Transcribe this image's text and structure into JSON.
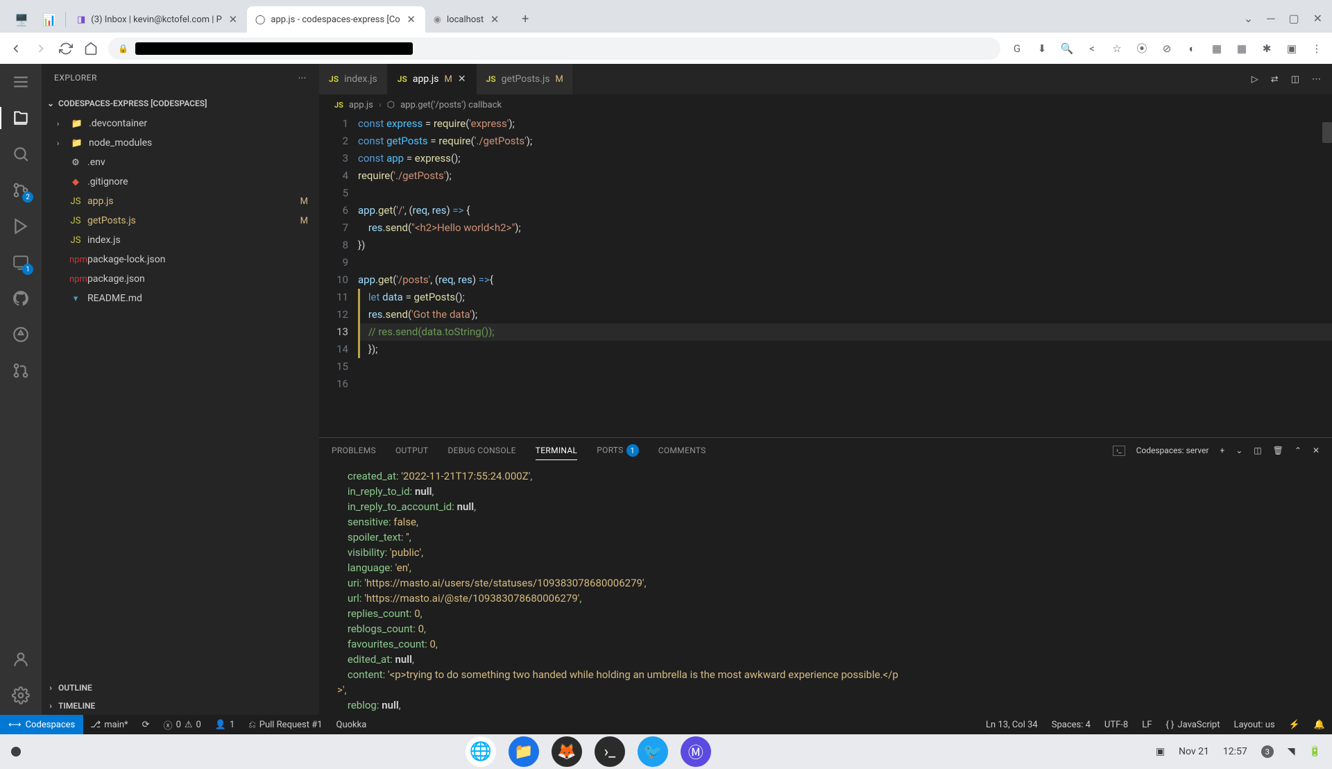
{
  "browser": {
    "tabs": [
      {
        "title": "(3) Inbox | kevin@kctofel.com | P"
      },
      {
        "title": "app.js - codespaces-express [Co"
      },
      {
        "title": "localhost"
      }
    ],
    "extensions": [
      "G",
      "⬇",
      "🔍",
      "<",
      "☆",
      "⦿",
      "⊘",
      "◐",
      "▦",
      "▦",
      "✱",
      "▣",
      "⋮"
    ]
  },
  "sidebar": {
    "title": "EXPLORER",
    "section": "CODESPACES-EXPRESS [CODESPACES]",
    "items": [
      {
        "icon": "📁",
        "color": "#4a8bca",
        "name": ".devcontainer",
        "chev": "›"
      },
      {
        "icon": "📁",
        "color": "#6aab4a",
        "name": "node_modules",
        "chev": "›"
      },
      {
        "icon": "⚙",
        "color": "#ccc",
        "name": ".env"
      },
      {
        "icon": "◆",
        "color": "#e05a43",
        "name": ".gitignore"
      },
      {
        "icon": "JS",
        "color": "#cbcb41",
        "name": "app.js",
        "modified": "M"
      },
      {
        "icon": "JS",
        "color": "#cbcb41",
        "name": "getPosts.js",
        "modified": "M"
      },
      {
        "icon": "JS",
        "color": "#cbcb41",
        "name": "index.js"
      },
      {
        "icon": "npm",
        "color": "#cb3837",
        "name": "package-lock.json"
      },
      {
        "icon": "npm",
        "color": "#cb3837",
        "name": "package.json"
      },
      {
        "icon": "▾",
        "color": "#519aba",
        "name": "README.md"
      }
    ],
    "outline": "OUTLINE",
    "timeline": "TIMELINE"
  },
  "activity_badges": {
    "scm": "2",
    "remote": "1"
  },
  "editor": {
    "tabs": [
      {
        "name": "index.js"
      },
      {
        "name": "app.js",
        "mod": "M",
        "active": true,
        "close": true
      },
      {
        "name": "getPosts.js",
        "mod": "M"
      }
    ],
    "breadcrumb": {
      "file": "app.js",
      "sym": "app.get('/posts') callback"
    },
    "code": [
      {
        "n": 1,
        "html": "<span class='tok-k'>const</span> <span class='tok-n'>express</span> <span class='tok-p'>=</span> <span class='tok-fn'>require</span><span class='tok-p'>(</span><span class='tok-s'>'express'</span><span class='tok-p'>);</span>"
      },
      {
        "n": 2,
        "html": "<span class='tok-k'>const</span> <span class='tok-n'>getPosts</span> <span class='tok-p'>=</span> <span class='tok-fn'>require</span><span class='tok-p'>(</span><span class='tok-s'>'./getPosts'</span><span class='tok-p'>);</span>"
      },
      {
        "n": 3,
        "html": "<span class='tok-k'>const</span> <span class='tok-n'>app</span> <span class='tok-p'>=</span> <span class='tok-fn'>express</span><span class='tok-p'>();</span>"
      },
      {
        "n": 4,
        "html": "<span class='tok-fn'>require</span><span class='tok-p'>(</span><span class='tok-s'>'./getPosts'</span><span class='tok-p'>);</span>"
      },
      {
        "n": 5,
        "html": ""
      },
      {
        "n": 6,
        "html": "<span class='tok-v'>app</span><span class='tok-p'>.</span><span class='tok-fn'>get</span><span class='tok-p'>(</span><span class='tok-s'>'/'</span><span class='tok-p'>, (</span><span class='tok-v'>req</span><span class='tok-p'>, </span><span class='tok-v'>res</span><span class='tok-p'>) </span><span class='tok-k'>=></span><span class='tok-p'> {</span>"
      },
      {
        "n": 7,
        "html": "    <span class='tok-v'>res</span><span class='tok-p'>.</span><span class='tok-fn'>send</span><span class='tok-p'>(</span><span class='tok-s'>\"&lt;h2&gt;Hello world&lt;h2&gt;\"</span><span class='tok-p'>);</span>"
      },
      {
        "n": 8,
        "html": "<span class='tok-p'>})</span>"
      },
      {
        "n": 9,
        "html": ""
      },
      {
        "n": 10,
        "html": "<span class='tok-v'>app</span><span class='tok-p'>.</span><span class='tok-fn'>get</span><span class='tok-p'>(</span><span class='tok-s'>'/posts'</span><span class='tok-p'>, (</span><span class='tok-v'>req</span><span class='tok-p'>, </span><span class='tok-v'>res</span><span class='tok-p'>) </span><span class='tok-k'>=></span><span class='tok-p'>{</span>"
      },
      {
        "n": 11,
        "html": "    <span class='tok-k'>let</span> <span class='tok-v'>data</span> <span class='tok-p'>=</span> <span class='tok-fn'>getPosts</span><span class='tok-p'>();</span>"
      },
      {
        "n": 12,
        "html": "    <span class='tok-v'>res</span><span class='tok-p'>.</span><span class='tok-fn'>send</span><span class='tok-p'>(</span><span class='tok-s'>'Got the data'</span><span class='tok-p'>);</span>"
      },
      {
        "n": 13,
        "html": "    <span class='tok-c'>// res.send(data.toString());</span>",
        "cur": true
      },
      {
        "n": 14,
        "html": "    <span class='tok-p'>});</span>"
      },
      {
        "n": 15,
        "html": ""
      },
      {
        "n": 16,
        "html": ""
      }
    ]
  },
  "panel": {
    "tabs": [
      "PROBLEMS",
      "OUTPUT",
      "DEBUG CONSOLE",
      "TERMINAL",
      "PORTS",
      "COMMENTS"
    ],
    "active": "TERMINAL",
    "ports_badge": "1",
    "term_label": "Codespaces: server",
    "terminal_lines": [
      "    created_at: <span class='ty'>'2022-11-21T17:55:24.000Z'</span>,",
      "    in_reply_to_id: <span class='tw'>null</span>,",
      "    in_reply_to_account_id: <span class='tw'>null</span>,",
      "    sensitive: <span class='ty'>false</span>,",
      "    spoiler_text: <span class='ty'>''</span>,",
      "    visibility: <span class='ty'>'public'</span>,",
      "    language: <span class='ty'>'en'</span>,",
      "    uri: <span class='ty'>'https://masto.ai/users/ste/statuses/109383078680006279'</span>,",
      "    url: <span class='ty'>'https://masto.ai/@ste/109383078680006279'</span>,",
      "    replies_count: <span class='tn'>0</span>,",
      "    reblogs_count: <span class='tn'>0</span>,",
      "    favourites_count: <span class='tn'>0</span>,",
      "    edited_at: <span class='tw'>null</span>,",
      "    content: <span class='ty'>'&lt;p&gt;trying to do something two handed while holding an umbrella is the most awkward experience possible.&lt;/p</span>",
      "<span class='ty'>&gt;'</span>,",
      "    reblog: <span class='tw'>null</span>,"
    ]
  },
  "status": {
    "codespaces": "Codespaces",
    "branch": "main*",
    "errors": "0",
    "warnings": "0",
    "people": "1",
    "pr": "Pull Request #1",
    "quokka": "Quokka",
    "pos": "Ln 13, Col 34",
    "spaces": "Spaces: 4",
    "enc": "UTF-8",
    "eol": "LF",
    "lang": "JavaScript",
    "layout": "Layout: us"
  },
  "taskbar": {
    "date": "Nov 21",
    "time": "12:57"
  }
}
